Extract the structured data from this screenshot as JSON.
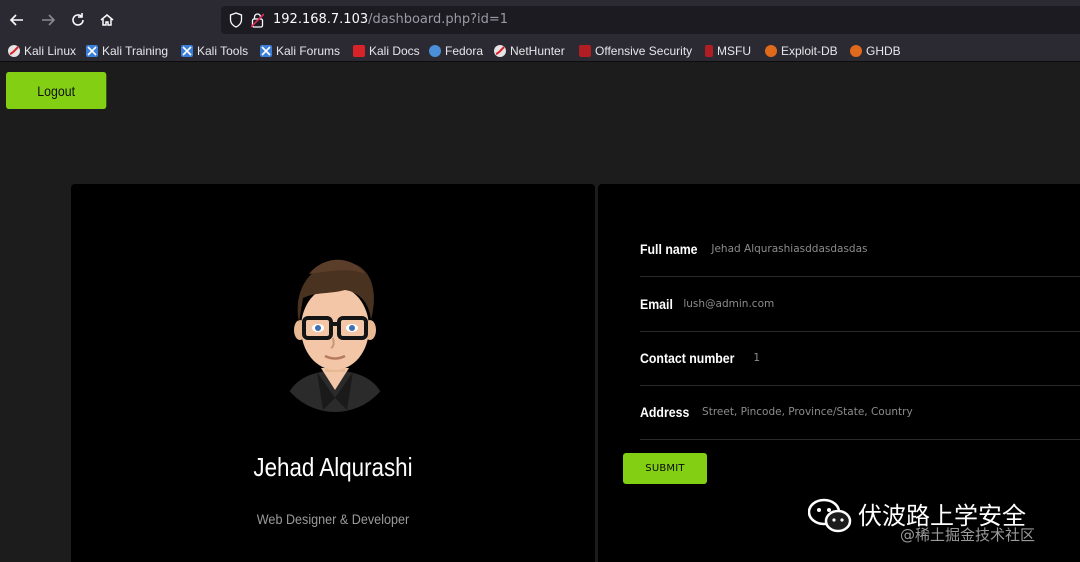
{
  "browser": {
    "url_host": "192.168.7.103",
    "url_path": "/dashboard.php?id=1",
    "bookmarks": [
      {
        "label": "Kali Linux",
        "icon": "kali-icon"
      },
      {
        "label": "Kali Training",
        "icon": "kali-training-icon"
      },
      {
        "label": "Kali Tools",
        "icon": "kali-tools-icon"
      },
      {
        "label": "Kali Forums",
        "icon": "kali-forums-icon"
      },
      {
        "label": "Kali Docs",
        "icon": "kali-docs-icon"
      },
      {
        "label": "Fedora",
        "icon": "fedora-icon"
      },
      {
        "label": "NetHunter",
        "icon": "nethunter-icon"
      },
      {
        "label": "Offensive Security",
        "icon": "offsec-icon"
      },
      {
        "label": "MSFU",
        "icon": "msfu-icon"
      },
      {
        "label": "Exploit-DB",
        "icon": "exploitdb-icon"
      },
      {
        "label": "GHDB",
        "icon": "ghdb-icon"
      }
    ]
  },
  "page": {
    "logout_label": "Logout",
    "profile": {
      "name": "Jehad Alqurashi",
      "role": "Web Designer & Developer"
    },
    "fields": [
      {
        "label": "Full name",
        "value": "Jehad Alqurashiasddasdasdas"
      },
      {
        "label": "Email",
        "value": "lush@admin.com"
      },
      {
        "label": "Contact number",
        "value": "1"
      },
      {
        "label": "Address",
        "value": "Street, Pincode, Province/State, Country"
      }
    ],
    "submit_label": "SUBMIT"
  },
  "watermark": {
    "title": "伏波路上学安全",
    "subtitle": "@稀土掘金技术社区"
  },
  "colors": {
    "accent": "#82cf13",
    "card_bg": "#000000",
    "page_bg": "#1c1c1c"
  }
}
